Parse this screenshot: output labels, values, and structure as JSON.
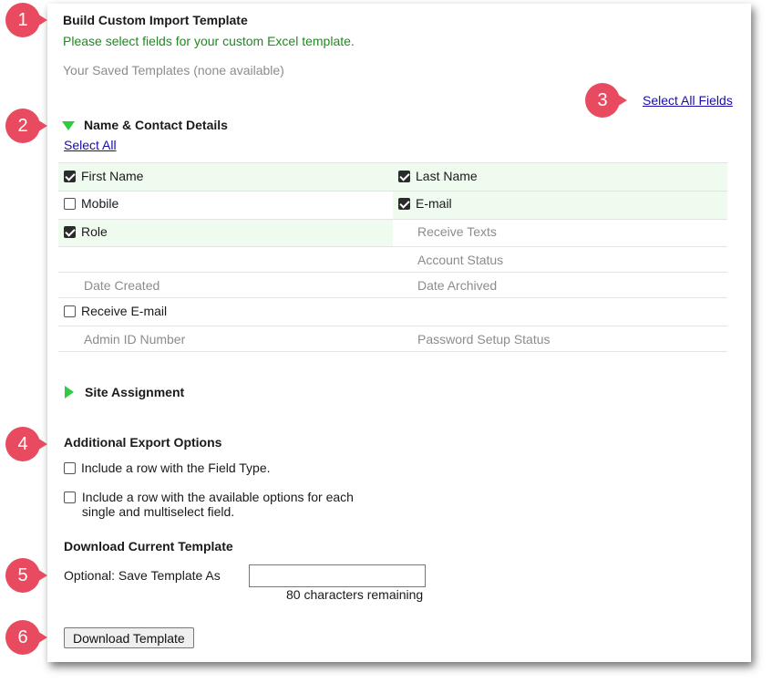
{
  "header": {
    "title": "Build Custom Import Template",
    "subtitle": "Please select fields for your custom Excel template.",
    "saved_templates": "Your Saved Templates (none available)",
    "select_all_fields": "Select All Fields"
  },
  "section_contact": {
    "title": "Name & Contact Details",
    "select_all": "Select All",
    "fields": {
      "first_name": "First Name",
      "last_name": "Last Name",
      "mobile": "Mobile",
      "email": "E-mail",
      "role": "Role",
      "receive_texts": "Receive Texts",
      "account_status": "Account Status",
      "date_created": "Date Created",
      "date_archived": "Date Archived",
      "receive_email": "Receive E-mail",
      "admin_id": "Admin ID Number",
      "password_setup": "Password Setup Status"
    },
    "checked": {
      "first_name": true,
      "last_name": true,
      "mobile": false,
      "email": true,
      "role": true,
      "receive_email": false
    }
  },
  "section_site": {
    "title": "Site Assignment"
  },
  "export_options": {
    "title": "Additional Export Options",
    "option1": "Include a row with the Field Type.",
    "option2_line1": "Include a row with the available options for each",
    "option2_line2": "single and multiselect field."
  },
  "download": {
    "title": "Download Current Template",
    "save_as_label": "Optional: Save Template As",
    "save_as_value": "",
    "remaining": "80 characters remaining",
    "button": "Download Template"
  },
  "badges": [
    "1",
    "2",
    "3",
    "4",
    "5",
    "6"
  ],
  "colors": {
    "badge": "#e84a5f",
    "triangle": "#2ecc40",
    "highlight": "#effbee",
    "link": "#1a0dab",
    "subtitle": "#1f8a1f"
  }
}
